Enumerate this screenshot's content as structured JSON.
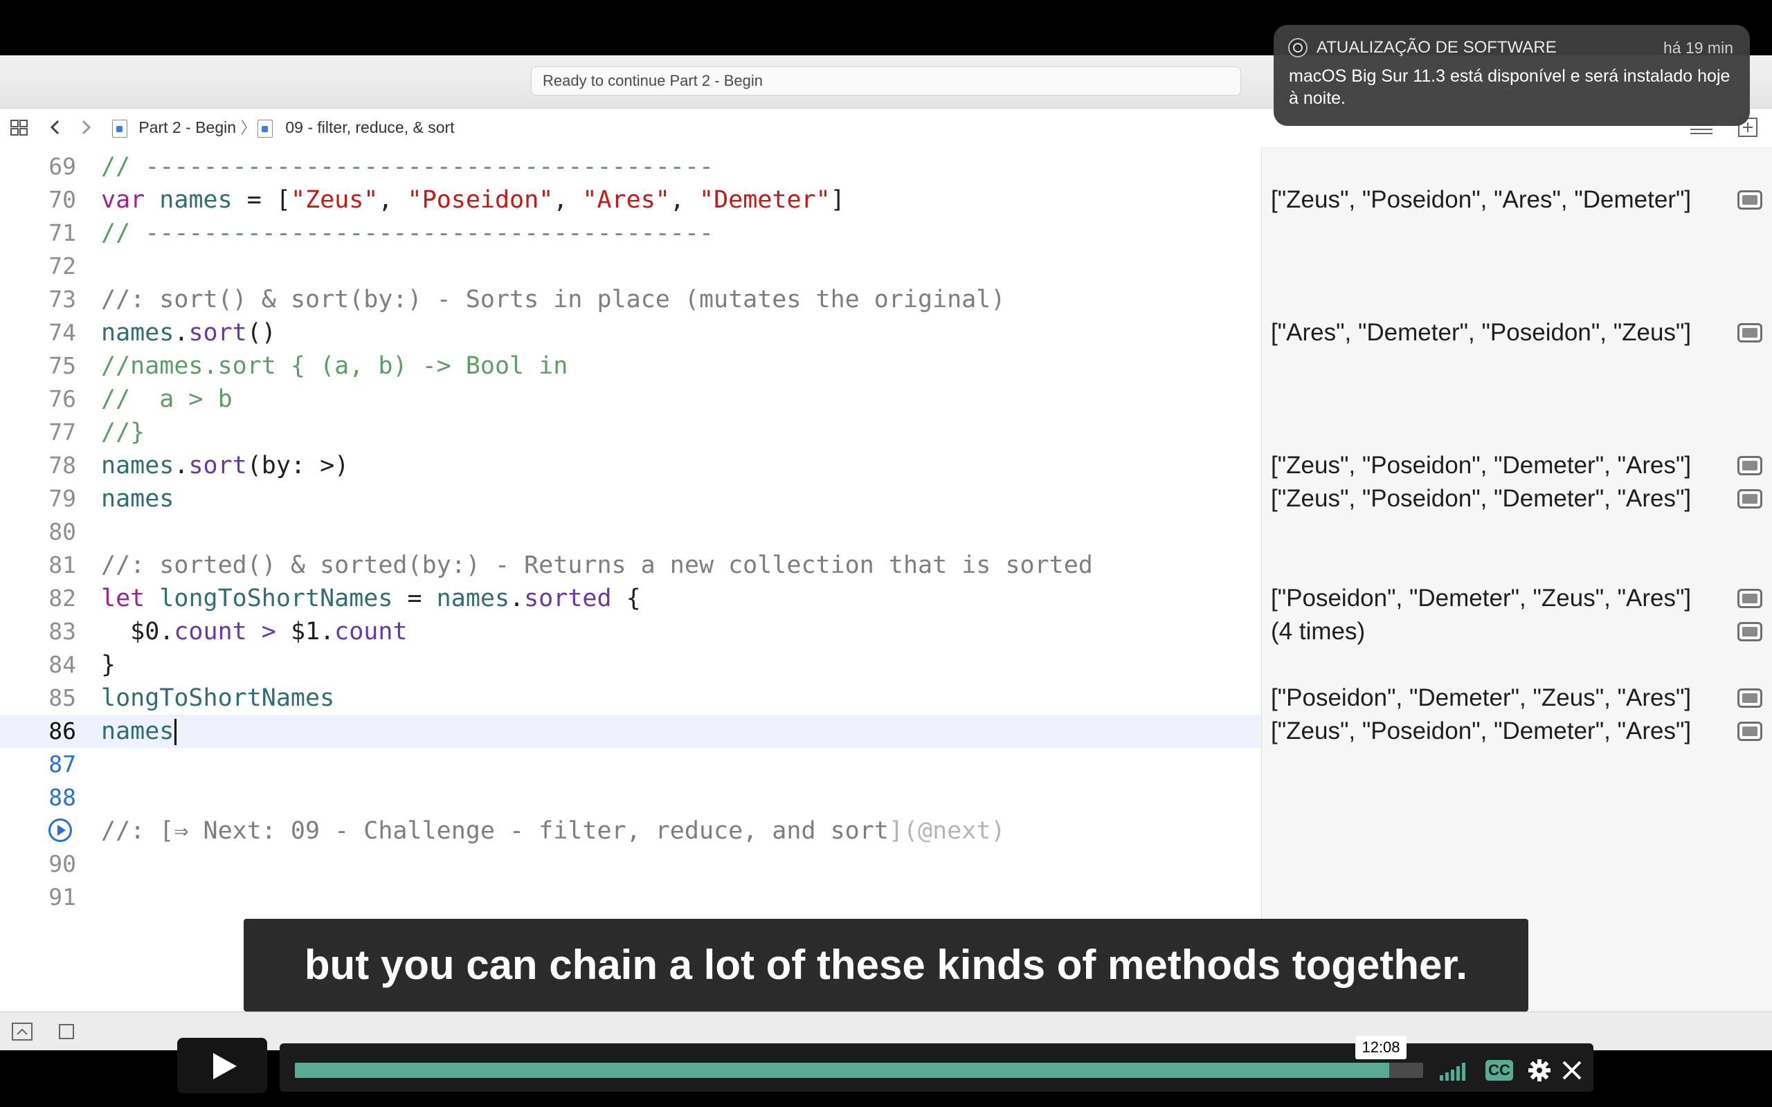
{
  "window": {
    "status": "Ready to continue Part 2 - Begin"
  },
  "breadcrumb": {
    "part": "Part 2 - Begin",
    "separator": "〉",
    "file": "09 - filter, reduce, & sort"
  },
  "editor": {
    "lines": [
      {
        "n": "69",
        "tokens": [
          {
            "t": "// ---------------------------------------",
            "c": "cm"
          }
        ]
      },
      {
        "n": "70",
        "tokens": [
          {
            "t": "var",
            "c": "kw"
          },
          {
            "t": " ",
            "c": "pl"
          },
          {
            "t": "names",
            "c": "id"
          },
          {
            "t": " = [",
            "c": "pl"
          },
          {
            "t": "\"Zeus\"",
            "c": "str"
          },
          {
            "t": ", ",
            "c": "pl"
          },
          {
            "t": "\"Poseidon\"",
            "c": "str"
          },
          {
            "t": ", ",
            "c": "pl"
          },
          {
            "t": "\"Ares\"",
            "c": "str"
          },
          {
            "t": ", ",
            "c": "pl"
          },
          {
            "t": "\"Demeter\"",
            "c": "str"
          },
          {
            "t": "]",
            "c": "pl"
          }
        ]
      },
      {
        "n": "71",
        "tokens": [
          {
            "t": "// ---------------------------------------",
            "c": "cm"
          }
        ]
      },
      {
        "n": "72",
        "tokens": []
      },
      {
        "n": "73",
        "tokens": [
          {
            "t": "//: sort() & sort(by:) - Sorts in place (mutates the original)",
            "c": "md"
          }
        ]
      },
      {
        "n": "74",
        "tokens": [
          {
            "t": "names",
            "c": "id"
          },
          {
            "t": ".",
            "c": "pl"
          },
          {
            "t": "sort",
            "c": "fn"
          },
          {
            "t": "()",
            "c": "pl"
          }
        ]
      },
      {
        "n": "75",
        "tokens": [
          {
            "t": "//names.sort { (a, b) -> Bool in",
            "c": "cm"
          }
        ]
      },
      {
        "n": "76",
        "tokens": [
          {
            "t": "//  a > b",
            "c": "cm"
          }
        ]
      },
      {
        "n": "77",
        "tokens": [
          {
            "t": "//}",
            "c": "cm"
          }
        ]
      },
      {
        "n": "78",
        "tokens": [
          {
            "t": "names",
            "c": "id"
          },
          {
            "t": ".",
            "c": "pl"
          },
          {
            "t": "sort",
            "c": "fn"
          },
          {
            "t": "(by: >)",
            "c": "pl"
          }
        ]
      },
      {
        "n": "79",
        "tokens": [
          {
            "t": "names",
            "c": "id"
          }
        ]
      },
      {
        "n": "80",
        "tokens": []
      },
      {
        "n": "81",
        "tokens": [
          {
            "t": "//: sorted() & sorted(by:) - Returns a new collection that is sorted",
            "c": "md"
          }
        ]
      },
      {
        "n": "82",
        "tokens": [
          {
            "t": "let",
            "c": "kw"
          },
          {
            "t": " ",
            "c": "pl"
          },
          {
            "t": "longToShortNames",
            "c": "id"
          },
          {
            "t": " = ",
            "c": "pl"
          },
          {
            "t": "names",
            "c": "id"
          },
          {
            "t": ".",
            "c": "pl"
          },
          {
            "t": "sorted",
            "c": "fn"
          },
          {
            "t": " {",
            "c": "pl"
          }
        ]
      },
      {
        "n": "83",
        "tokens": [
          {
            "t": "  $0.",
            "c": "pl"
          },
          {
            "t": "count",
            "c": "fn"
          },
          {
            "t": " > ",
            "c": "fn"
          },
          {
            "t": "$1.",
            "c": "pl"
          },
          {
            "t": "count",
            "c": "fn"
          }
        ]
      },
      {
        "n": "84",
        "tokens": [
          {
            "t": "}",
            "c": "pl"
          }
        ]
      },
      {
        "n": "85",
        "tokens": [
          {
            "t": "longToShortNames",
            "c": "id"
          }
        ]
      },
      {
        "n": "86",
        "tokens": [
          {
            "t": "names",
            "c": "id"
          }
        ],
        "current": true
      },
      {
        "n": "87",
        "tokens": [],
        "blue": true
      },
      {
        "n": "88",
        "tokens": [],
        "blue": true
      },
      {
        "n": "",
        "tokens": [
          {
            "t": "//: [",
            "c": "md"
          },
          {
            "t": "⇒ Next: 09 - Challenge - filter, reduce, and sort",
            "c": "md"
          },
          {
            "t": "](@next)",
            "c": "mdl"
          }
        ],
        "run": true
      },
      {
        "n": "90",
        "tokens": []
      },
      {
        "n": "91",
        "tokens": []
      }
    ]
  },
  "results": [
    {
      "line": 1,
      "text": "[\"Zeus\", \"Poseidon\", \"Ares\", \"Demeter\"]"
    },
    {
      "line": 5,
      "text": "[\"Ares\", \"Demeter\", \"Poseidon\", \"Zeus\"]"
    },
    {
      "line": 9,
      "text": "[\"Zeus\", \"Poseidon\", \"Demeter\", \"Ares\"]"
    },
    {
      "line": 10,
      "text": "[\"Zeus\", \"Poseidon\", \"Demeter\", \"Ares\"]"
    },
    {
      "line": 13,
      "text": "[\"Poseidon\", \"Demeter\", \"Zeus\", \"Ares\"]"
    },
    {
      "line": 14,
      "text": "(4 times)"
    },
    {
      "line": 16,
      "text": "[\"Poseidon\", \"Demeter\", \"Zeus\", \"Ares\"]"
    },
    {
      "line": 17,
      "text": "[\"Zeus\", \"Poseidon\", \"Demeter\", \"Ares\"]"
    }
  ],
  "caption": "but you can chain a lot of these kinds of methods together.",
  "player": {
    "time_tooltip": "12:08",
    "progress": 0.97,
    "cc_label": "CC"
  },
  "notification": {
    "app": "ATUALIZAÇÃO DE SOFTWARE",
    "time": "há 19 min",
    "message": "macOS Big Sur 11.3 está disponível e será instalado hoje à noite."
  },
  "colors": {
    "accent": "#2a6fd6",
    "progress": "#5aab94",
    "keyword": "#9b2393",
    "string": "#c41a16",
    "comment": "#5d9e67",
    "identifier": "#326d74",
    "method": "#6c36a9"
  }
}
